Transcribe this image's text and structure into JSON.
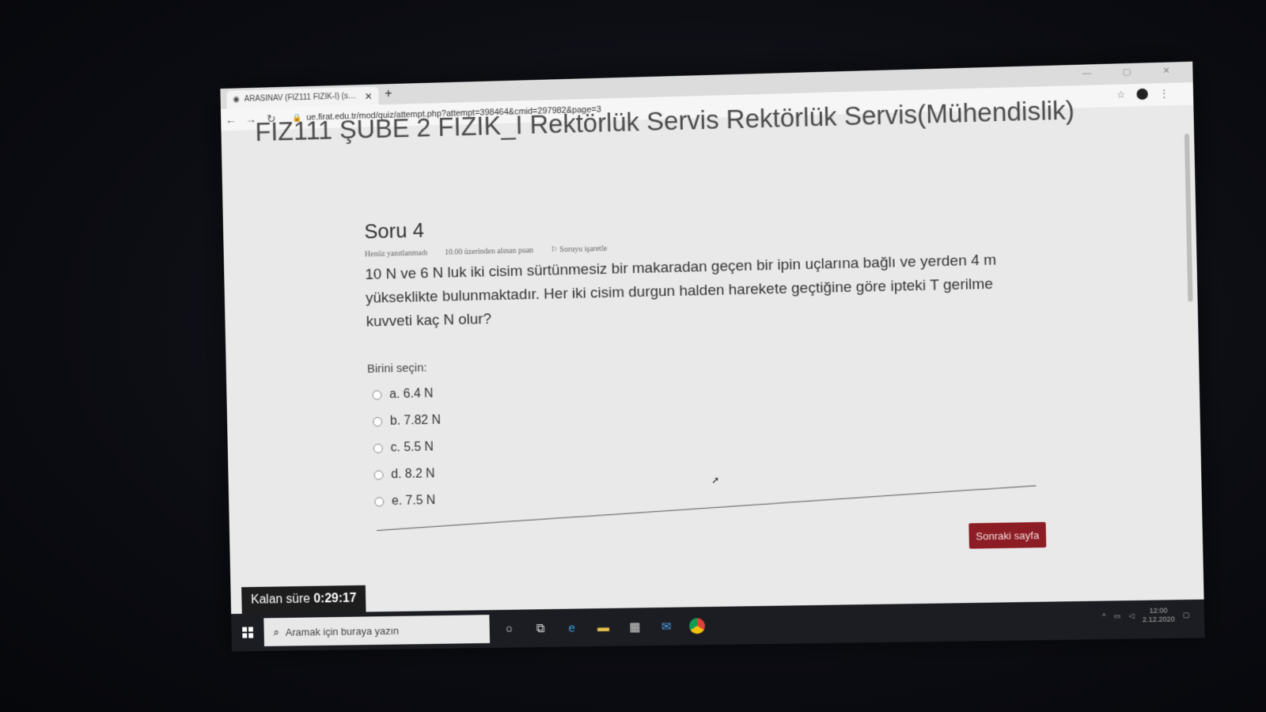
{
  "browser": {
    "tab_title": "ARASINAV (FIZ111 FIZIK-I) (sayfa",
    "tab_close": "✕",
    "new_tab": "+",
    "url": "ue.firat.edu.tr/mod/quiz/attempt.php?attempt=398464&cmid=297982&page=3",
    "window_controls": "— ▢ ✕"
  },
  "course": {
    "title": "FIZ111 ŞUBE 2 FIZIK_I Rektörlük Servis Rektörlük Servis(Mühendislik)"
  },
  "question": {
    "heading": "Soru 4",
    "status": "Henüz yanıtlanmadı",
    "points": "10.00 üzerinden alınan puan",
    "flag": "Soruyu işaretle",
    "text": "10 N ve 6 N luk iki cisim sürtünmesiz bir makaradan geçen bir ipin uçlarına bağlı ve yerden 4 m yükseklikte bulunmaktadır. Her iki cisim durgun halden harekete geçtiğine göre ipteki T gerilme kuvveti kaç N olur?",
    "prompt": "Birini seçin:",
    "options": [
      {
        "label": "a. 6.4 N"
      },
      {
        "label": "b. 7.82 N"
      },
      {
        "label": "c. 5.5 N"
      },
      {
        "label": "d. 8.2 N"
      },
      {
        "label": "e. 7.5 N"
      }
    ]
  },
  "navigation": {
    "next_label": "Sonraki sayfa"
  },
  "timer": {
    "label": "Kalan süre",
    "value": "0:29:17"
  },
  "taskbar": {
    "search_placeholder": "Aramak için buraya yazın",
    "clock_time": "12:00",
    "clock_date": "2.12.2020"
  }
}
